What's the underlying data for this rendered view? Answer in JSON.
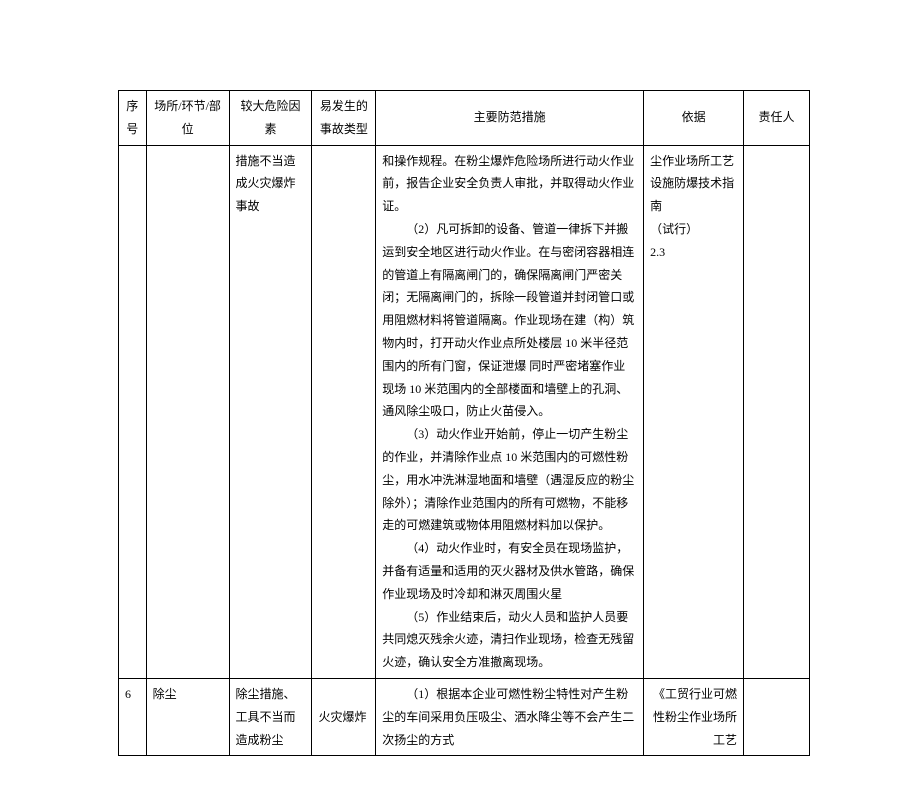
{
  "headers": {
    "seq": "序号",
    "place": "场所/环节/部位",
    "risk": "较大危险因素",
    "type": "易发生的事故类型",
    "measure": "主要防范措施",
    "basis": "依据",
    "owner": "责任人"
  },
  "rows": [
    {
      "seq": "",
      "place": "",
      "risk": "措施不当造成火灾爆炸事故",
      "type": "",
      "m0": "和操作规程。在粉尘爆炸危险场所进行动火作业前，报告企业安全负责人审批，并取得动火作业证。",
      "m2": "（2）凡可拆卸的设备、管道一律拆下并搬运到安全地区进行动火作业。在与密闭容器相连的管道上有隔离闸门的，确保隔离闸门严密关闭；无隔离闸门的，拆除一段管道并封闭管口或用阻燃材料将管道隔离。作业现场在建（构）筑物内时，打开动火作业点所处楼层 10 米半径范围内的所有门窗，保证泄爆 同时严密堵塞作业现场 10 米范围内的全部楼面和墙壁上的孔洞、通风除尘吸口，防止火苗侵入。",
      "m3": "（3）动火作业开始前，停止一切产生粉尘的作业，并清除作业点 10 米范围内的可燃性粉尘，用水冲洗淋湿地面和墙壁（遇湿反应的粉尘除外）；清除作业范围内的所有可燃物，不能移走的可燃建筑或物体用阻燃材料加以保护。",
      "m4": "（4）动火作业时，有安全员在现场监护，并备有适量和适用的灭火器材及供水管路，确保作业现场及时冷却和淋灭周围火星",
      "m5": "（5）作业结束后，动火人员和监护人员要共同熄灭残余火迹，清扫作业现场，检查无残留火迹，确认安全方准撤离现场。",
      "basis": "尘作业场所工艺设施防爆技术指南\n（试行）\n2.3",
      "owner": ""
    },
    {
      "seq": "6",
      "place": "除尘",
      "risk": "除尘措施、工具不当而造成粉尘",
      "type": "火灾爆炸",
      "m0": "",
      "m1": "（1）根据本企业可燃性粉尘特性对产生粉尘的车间采用负压吸尘、洒水降尘等不会产生二次扬尘的方式",
      "basis": "《工贸行业可燃性粉尘作业场所工艺",
      "owner": ""
    }
  ]
}
